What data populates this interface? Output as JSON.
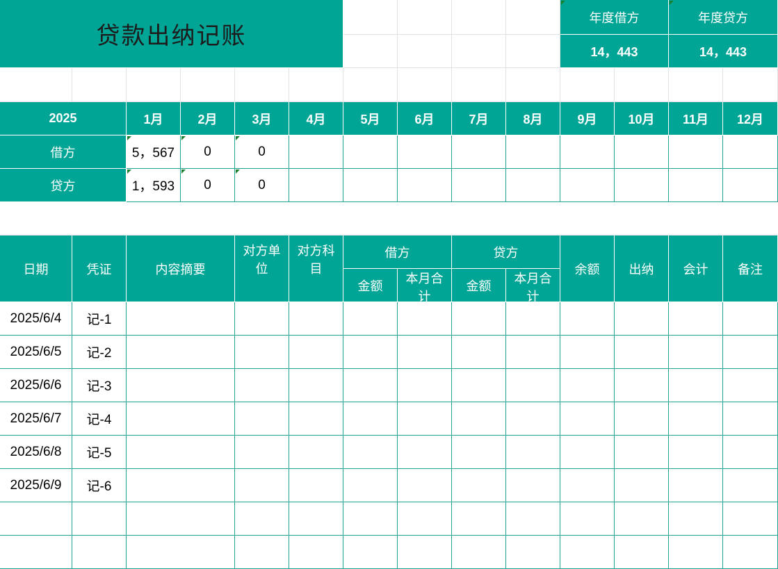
{
  "title": "贷款出纳记账",
  "annual": {
    "debit_label": "年度借方",
    "debit_value": "14，443",
    "credit_label": "年度贷方",
    "credit_value": "14，443"
  },
  "summary": {
    "year": "2025",
    "months": [
      "1月",
      "2月",
      "3月",
      "4月",
      "5月",
      "6月",
      "7月",
      "8月",
      "9月",
      "10月",
      "11月",
      "12月"
    ],
    "debit_label": "借方",
    "credit_label": "贷方",
    "debit_values": [
      "5，567",
      "0",
      "0",
      "",
      "",
      "",
      "",
      "",
      "",
      "",
      "",
      ""
    ],
    "credit_values": [
      "1，593",
      "0",
      "0",
      "",
      "",
      "",
      "",
      "",
      "",
      "",
      "",
      ""
    ]
  },
  "ledger": {
    "headers": {
      "date": "日期",
      "voucher": "凭证",
      "summary": "内容摘要",
      "counter_unit": "对方单位",
      "counter_subject": "对方科目",
      "debit": "借方",
      "credit": "贷方",
      "amount": "金额",
      "month_total": "本月合计",
      "balance": "余额",
      "cashier": "出纳",
      "accountant": "会计",
      "note": "备注"
    },
    "rows": [
      {
        "date": "2025/6/4",
        "voucher": "记-1"
      },
      {
        "date": "2025/6/5",
        "voucher": "记-2"
      },
      {
        "date": "2025/6/6",
        "voucher": "记-3"
      },
      {
        "date": "2025/6/7",
        "voucher": "记-4"
      },
      {
        "date": "2025/6/8",
        "voucher": "记-5"
      },
      {
        "date": "2025/6/9",
        "voucher": "记-6"
      }
    ]
  }
}
